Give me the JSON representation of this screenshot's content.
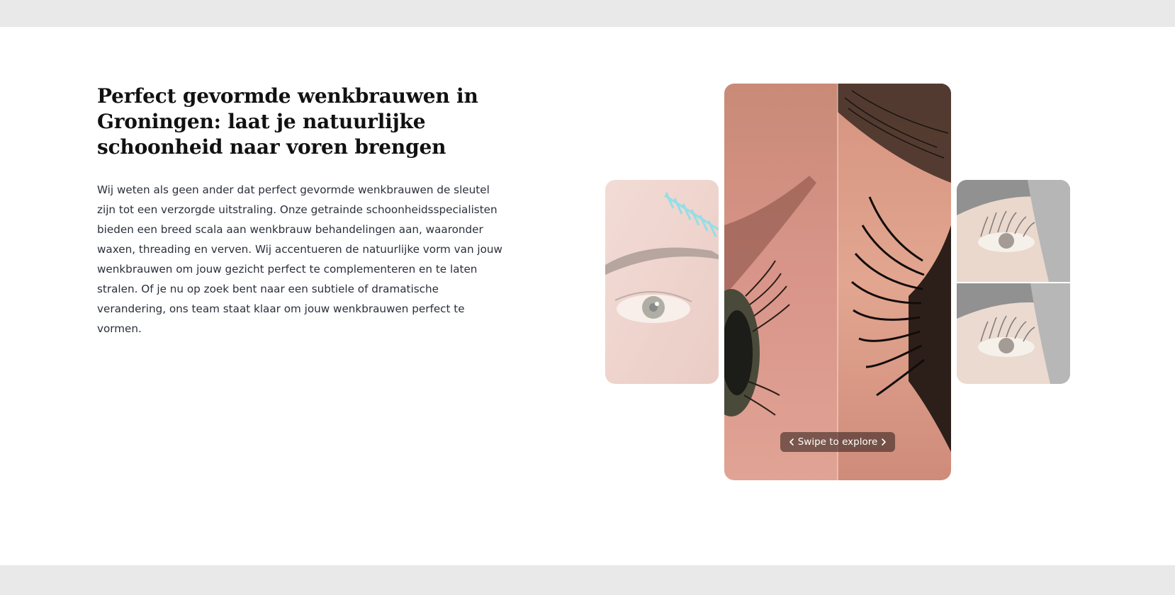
{
  "section": {
    "heading": "Perfect gevormde wenkbrauwen in Groningen: laat je natuurlijke schoonheid naar voren brengen",
    "body": "Wij weten als geen ander dat perfect gevormde wenkbrauwen de sleutel zijn tot een verzorgde uitstraling. Onze getrainde schoonheidsspecialisten bieden een breed scala aan wenkbrauw behandelingen aan, waaronder waxen, threading en verven. Wij accentueren de natuurlijke vorm van jouw wenkbrauwen om jouw gezicht perfect te complementeren en te laten stralen. Of je nu op zoek bent naar een subtiele of dramatische verandering, ons team staat klaar om jouw wenkbrauwen perfect te vormen."
  },
  "gallery": {
    "swipe_label": "Swipe to explore",
    "prev_icon": "chevron-left-icon",
    "next_icon": "chevron-right-icon"
  },
  "colors": {
    "page_band": "#e9e9e9",
    "section_bg": "#ffffff",
    "heading": "#111111",
    "body_text": "#2a2f3a"
  }
}
